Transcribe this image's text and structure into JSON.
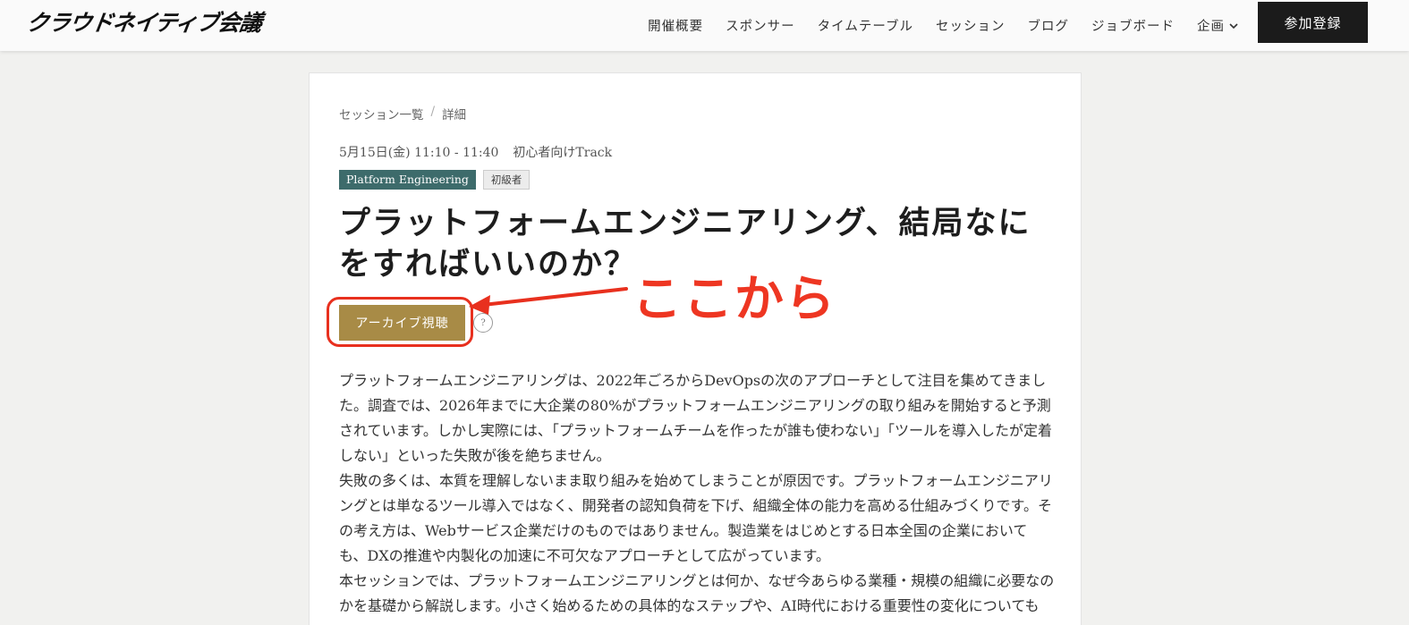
{
  "header": {
    "logo": "クラウドネイティブ会議",
    "nav": [
      "開催概要",
      "スポンサー",
      "タイムテーブル",
      "セッション",
      "ブログ",
      "ジョブボード"
    ],
    "nav_dropdown": "企画",
    "register_label": "参加登録",
    "chevron_icon": "chevron-down-icon"
  },
  "breadcrumb": {
    "parent": "セッション一覧",
    "separator": "/",
    "current": "詳細"
  },
  "session": {
    "schedule": "5月15日(金) 11:10 - 11:40",
    "track": "初心者向けTrack",
    "tag": "Platform Engineering",
    "tag_color": "#3d6b6b",
    "level": "初級者",
    "title": "プラットフォームエンジニアリング、結局なにをすればいいのか？",
    "archive_label": "アーカイブ視聴",
    "archive_color": "#a88b46",
    "help_label": "?",
    "description": [
      " プラットフォームエンジニアリングは、2022年ごろからDevOpsの次のアプローチとして注目を集めてきました。調査では、2026年までに大企業の80%がプラットフォームエンジニアリングの取り組みを開始すると予測されています。しかし実際には、「プラットフォームチームを作ったが誰も使わない」「ツールを導入したが定着しない」といった失敗が後を絶ちません。",
      "失敗の多くは、本質を理解しないまま取り組みを始めてしまうことが原因です。プラットフォームエンジニアリングとは単なるツール導入ではなく、開発者の認知負荷を下げ、組織全体の能力を高める仕組みづくりです。その考え方は、Webサービス企業だけのものではありません。製造業をはじめとする日本全国の企業においても、DXの推進や内製化の加速に不可欠なアプローチとして広がっています。",
      "本セッションでは、プラットフォームエンジニアリングとは何か、なぜ今あらゆる業種・規模の組織に必要なのかを基礎から解説します。小さく始めるための具体的なステップや、AI時代における重要性の変化についても"
    ]
  },
  "annotation": {
    "label": "ここから",
    "color": "#e8301e"
  }
}
